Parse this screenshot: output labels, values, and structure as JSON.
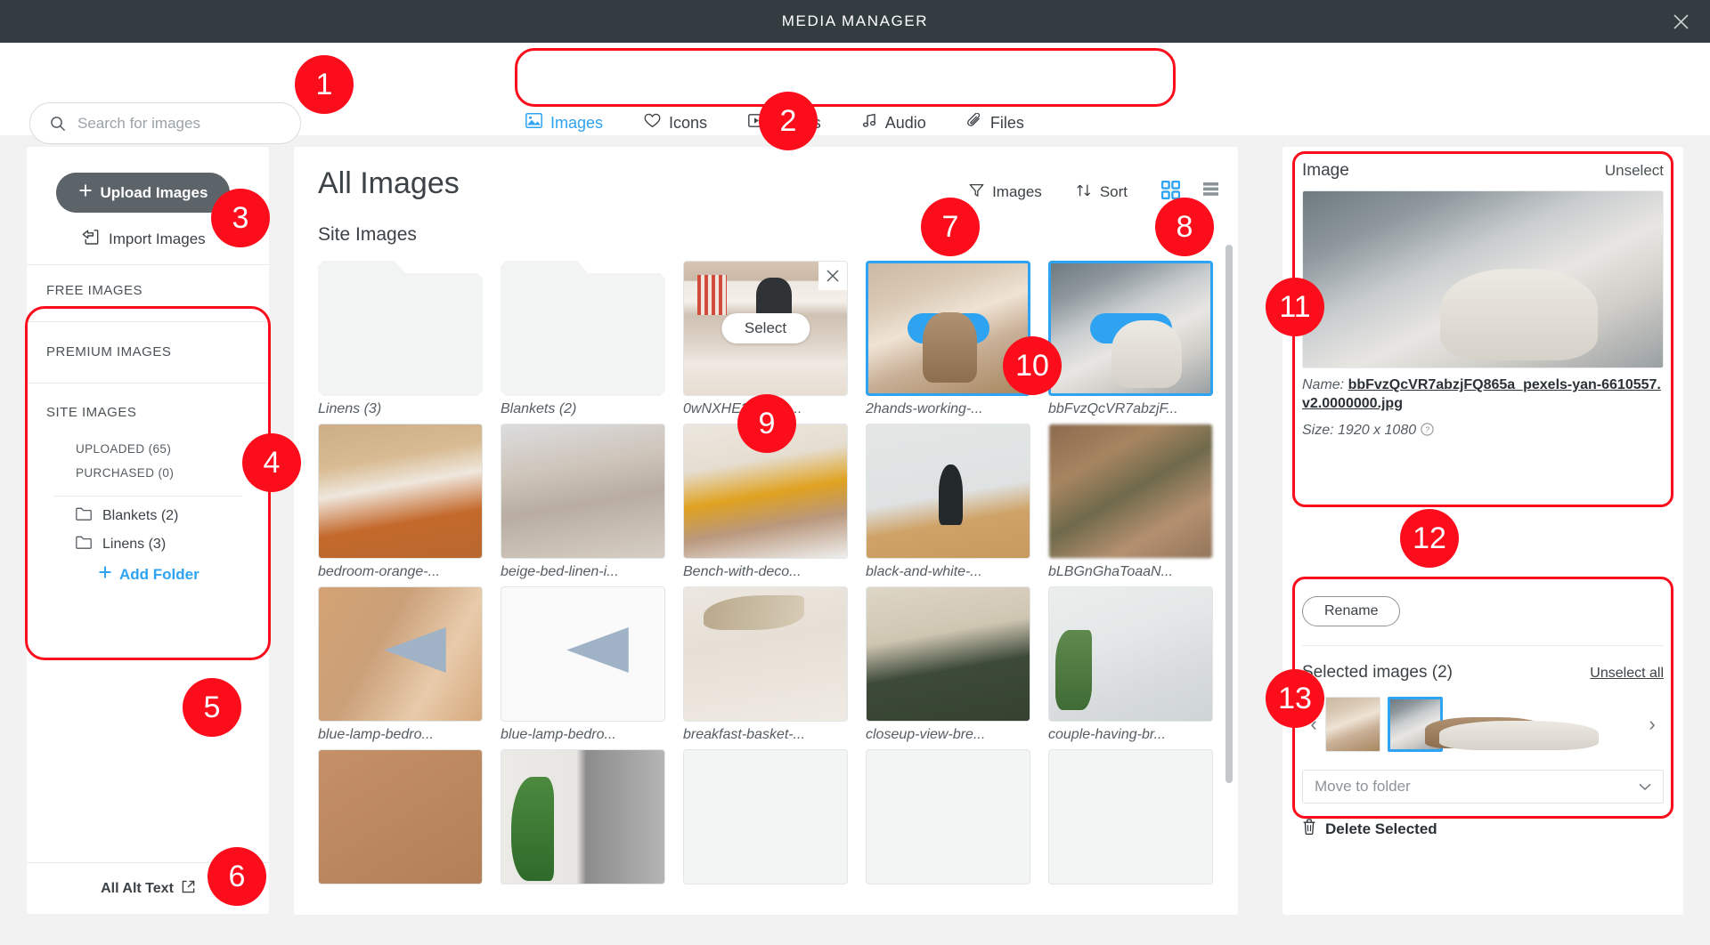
{
  "window": {
    "title": "MEDIA MANAGER",
    "close_label": "✕"
  },
  "search": {
    "placeholder": "Search for images",
    "value": ""
  },
  "tabs": [
    {
      "label": "Images",
      "icon": "image-icon",
      "active": true
    },
    {
      "label": "Icons",
      "icon": "heart-icon",
      "active": false
    },
    {
      "label": "Videos",
      "icon": "video-icon",
      "active": false
    },
    {
      "label": "Audio",
      "icon": "audio-icon",
      "active": false
    },
    {
      "label": "Files",
      "icon": "paperclip-icon",
      "active": false
    }
  ],
  "sidebar": {
    "upload_label": "Upload Images",
    "import_label": "Import Images",
    "sections": [
      {
        "label": "FREE IMAGES"
      },
      {
        "label": "PREMIUM IMAGES"
      },
      {
        "label": "SITE IMAGES"
      }
    ],
    "site_subitems": [
      {
        "label": "UPLOADED (65)"
      },
      {
        "label": "PURCHASED (0)"
      }
    ],
    "folders": [
      {
        "label": "Blankets (2)"
      },
      {
        "label": "Linens (3)"
      }
    ],
    "add_folder_label": "Add Folder",
    "all_alt_text_label": "All Alt Text"
  },
  "main": {
    "title": "All Images",
    "subtitle": "Site Images",
    "filter_label": "Images",
    "sort_label": "Sort",
    "grid_view_active": true,
    "list_view_active": false,
    "select_button_label": "Select",
    "items": [
      {
        "caption": "Linens (3)",
        "type": "folder",
        "style": ""
      },
      {
        "caption": "Blankets (2)",
        "type": "folder",
        "style": ""
      },
      {
        "caption": "0wNXHE3DPXta...",
        "type": "image",
        "style": "ph-weaving",
        "hover": true
      },
      {
        "caption": "2hands-working-...",
        "type": "image",
        "style": "ph-hands1",
        "selected": true
      },
      {
        "caption": "bbFvzQcVR7abzjF...",
        "type": "image",
        "style": "ph-hands2",
        "selected": true
      },
      {
        "caption": "bedroom-orange-...",
        "type": "image",
        "style": "ph-bedorange"
      },
      {
        "caption": "beige-bed-linen-i...",
        "type": "image",
        "style": "ph-beige"
      },
      {
        "caption": "Bench-with-deco...",
        "type": "image",
        "style": "ph-bench"
      },
      {
        "caption": "black-and-white-...",
        "type": "image",
        "style": "ph-vase"
      },
      {
        "caption": "bLBGnGhaToaaN...",
        "type": "image",
        "style": "ph-blurwarm"
      },
      {
        "caption": "blue-lamp-bedro...",
        "type": "image",
        "style": "ph-lamp1"
      },
      {
        "caption": "blue-lamp-bedro...",
        "type": "image",
        "style": "ph-lamp2"
      },
      {
        "caption": "breakfast-basket-...",
        "type": "image",
        "style": "ph-pampas"
      },
      {
        "caption": "closeup-view-bre...",
        "type": "image",
        "style": "ph-breakfast"
      },
      {
        "caption": "couple-having-br...",
        "type": "image",
        "style": "ph-couple"
      },
      {
        "caption": "",
        "type": "image",
        "style": "ph-tan"
      },
      {
        "caption": "",
        "type": "image",
        "style": "ph-plantdoor"
      },
      {
        "caption": "",
        "type": "image",
        "style": "ph-empty"
      },
      {
        "caption": "",
        "type": "image",
        "style": "ph-empty"
      },
      {
        "caption": "",
        "type": "image",
        "style": "ph-empty"
      }
    ]
  },
  "details": {
    "heading": "Image",
    "unselect_label": "Unselect",
    "name_key": "Name:",
    "name_value": "bbFvzQcVR7abzjFQ865a_pexels-yan-6610557.v2.0000000.jpg",
    "size_key": "Size:",
    "size_value": "1920 x 1080",
    "help_icon": "question-mark-icon",
    "rename_label": "Rename"
  },
  "selected_panel": {
    "heading": "Selected images (2)",
    "unselect_all_label": "Unselect all",
    "prev_label": "‹",
    "next_label": "›",
    "move_to_folder_label": "Move to folder",
    "delete_selected_label": "Delete Selected",
    "thumbs": [
      {
        "style": "ph-hands1",
        "active": false
      },
      {
        "style": "ph-hands2",
        "active": true
      }
    ]
  },
  "annotations": [
    {
      "n": "1"
    },
    {
      "n": "2"
    },
    {
      "n": "3"
    },
    {
      "n": "4"
    },
    {
      "n": "5"
    },
    {
      "n": "6"
    },
    {
      "n": "7"
    },
    {
      "n": "8"
    },
    {
      "n": "9"
    },
    {
      "n": "10"
    },
    {
      "n": "11"
    },
    {
      "n": "12"
    },
    {
      "n": "13"
    }
  ],
  "colors": {
    "accent": "#2ea3f2",
    "titlebar": "#333c41",
    "annotation": "#fc0d1b",
    "upload_btn": "#5c6369"
  }
}
